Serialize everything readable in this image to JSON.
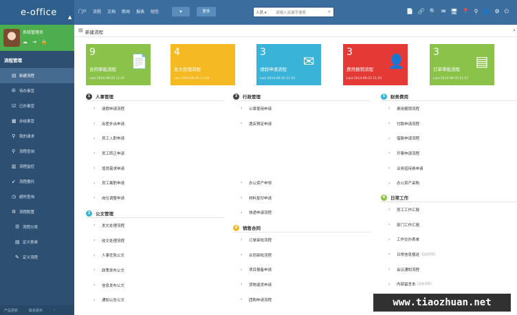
{
  "app": {
    "logo": "e-office"
  },
  "topnav": {
    "items": [
      "门户",
      "流程",
      "文档",
      "新闻",
      "报表",
      "短信"
    ],
    "more_icon": "▾",
    "button": "更多"
  },
  "search": {
    "scope": "人员 ▾",
    "placeholder": "请输入关键字搜索"
  },
  "top_icons": [
    "📄",
    "🔗",
    "🔍",
    "✉",
    "🖥",
    "📍",
    "⚲",
    "👤",
    "⚙",
    "⏻"
  ],
  "user": {
    "name": "系统管理员",
    "icons": [
      "☁",
      "⇥",
      "🔒"
    ]
  },
  "sidebar": {
    "title": "流程管理",
    "items": [
      {
        "icon": "▤",
        "label": "新建流程",
        "active": true,
        "sub": false
      },
      {
        "icon": "✇",
        "label": "待办事宜",
        "active": false,
        "sub": false
      },
      {
        "icon": "☑",
        "label": "已办事宜",
        "active": false,
        "sub": false
      },
      {
        "icon": "▦",
        "label": "办结事宜",
        "active": false,
        "sub": false
      },
      {
        "icon": "⚲",
        "label": "我的请求",
        "active": false,
        "sub": false
      },
      {
        "icon": "⚲",
        "label": "流程查询",
        "active": false,
        "sub": false
      },
      {
        "icon": "▥",
        "label": "流程监控",
        "active": false,
        "sub": false
      },
      {
        "icon": "➹",
        "label": "流程委托",
        "active": false,
        "sub": false
      },
      {
        "icon": "◷",
        "label": "超时查询",
        "active": false,
        "sub": false
      },
      {
        "icon": "⚙",
        "label": "流程配置",
        "active": false,
        "sub": false
      },
      {
        "icon": "☰",
        "label": "流程分类",
        "active": false,
        "sub": true
      },
      {
        "icon": "▤",
        "label": "定义表单",
        "active": false,
        "sub": true
      },
      {
        "icon": "✎",
        "label": "定义流程",
        "active": false,
        "sub": true
      }
    ],
    "footer": [
      "产品更新",
      "联系服务",
      "‹"
    ]
  },
  "page": {
    "title": "新建流程",
    "icon": "▤"
  },
  "tiles": [
    {
      "count": "9",
      "title": "合同审批流程",
      "date": "Last  2014-09-25 11:47",
      "color": "#8bc34a",
      "icon": "📄"
    },
    {
      "count": "4",
      "title": "发文处理流程",
      "date": "Last  2014-09-25 11:50",
      "color": "#f5b921",
      "icon": ""
    },
    {
      "count": "3",
      "title": "请假申请流程",
      "date": "Last  2014-09-25 11:53",
      "color": "#39b3d7",
      "icon": "✉"
    },
    {
      "count": "3",
      "title": "费用报销流程",
      "date": "Last  2014-09-25 11:55",
      "color": "#e53935",
      "icon": "👤"
    },
    {
      "count": "3",
      "title": "订单审批流程",
      "date": "Last  2014-09-25 11:57",
      "color": "#8bc34a",
      "icon": "▤"
    }
  ],
  "sections": [
    {
      "num": "1",
      "title": "人事管理",
      "color": "#444444",
      "items": [
        {
          "label": "请假申请流程",
          "note": ""
        },
        {
          "label": "出差外出申请",
          "note": ""
        },
        {
          "label": "员工入职申请",
          "note": ""
        },
        {
          "label": "员工转正申请",
          "note": ""
        },
        {
          "label": "增员需求申请",
          "note": ""
        },
        {
          "label": "员工离职申请",
          "note": ""
        },
        {
          "label": "岗位调整申请",
          "note": ""
        }
      ]
    },
    {
      "num": "2",
      "title": "公文管理",
      "color": "#39b3d7",
      "items": [
        {
          "label": "发文处理流程",
          "note": ""
        },
        {
          "label": "收文处理流程",
          "note": ""
        },
        {
          "label": "人事任免公文",
          "note": ""
        },
        {
          "label": "政策发布公文",
          "note": ""
        },
        {
          "label": "信息发布公文",
          "note": ""
        },
        {
          "label": "通知公告公文",
          "note": ""
        }
      ]
    },
    {
      "num": "3",
      "title": "行政管理",
      "color": "#444444",
      "items": [
        {
          "label": "公章使用申请",
          "note": ""
        },
        {
          "label": "酒店预定申请",
          "note": ""
        }
      ]
    },
    {
      "num": "",
      "title": "",
      "color": "#444444",
      "items": [
        {
          "label": "办公资产申领",
          "note": ""
        },
        {
          "label": "材料复印申请",
          "note": ""
        },
        {
          "label": "快递申请流程",
          "note": ""
        }
      ]
    },
    {
      "num": "4",
      "title": "销售合同",
      "color": "#f5b921",
      "items": [
        {
          "label": "订单审批流程",
          "note": ""
        },
        {
          "label": "合同审批流程",
          "note": ""
        },
        {
          "label": "项目报备申请",
          "note": ""
        },
        {
          "label": "货物退货申请",
          "note": ""
        },
        {
          "label": "团购申请流程",
          "note": ""
        }
      ]
    },
    {
      "num": "5",
      "title": "财务费用",
      "color": "#39b3d7",
      "items": [
        {
          "label": "费用报销流程",
          "note": ""
        },
        {
          "label": "付款申请流程",
          "note": ""
        },
        {
          "label": "借款申请流程",
          "note": ""
        },
        {
          "label": "开票申请流程",
          "note": ""
        },
        {
          "label": "业务招待费申请",
          "note": ""
        },
        {
          "label": "办公资产采购",
          "note": ""
        }
      ]
    },
    {
      "num": "6",
      "title": "日常工作",
      "color": "#8bc34a",
      "items": [
        {
          "label": "员工工作汇报",
          "note": ""
        },
        {
          "label": "部门工作汇报",
          "note": ""
        },
        {
          "label": "工作交办表单",
          "note": ""
        },
        {
          "label": "日常信息报送",
          "note": "(自由流程)"
        },
        {
          "label": "会议通知流程",
          "note": ""
        },
        {
          "label": "内部留言本",
          "note": "(自由流程)"
        }
      ]
    }
  ],
  "watermark": "www.tiaozhuan.net"
}
